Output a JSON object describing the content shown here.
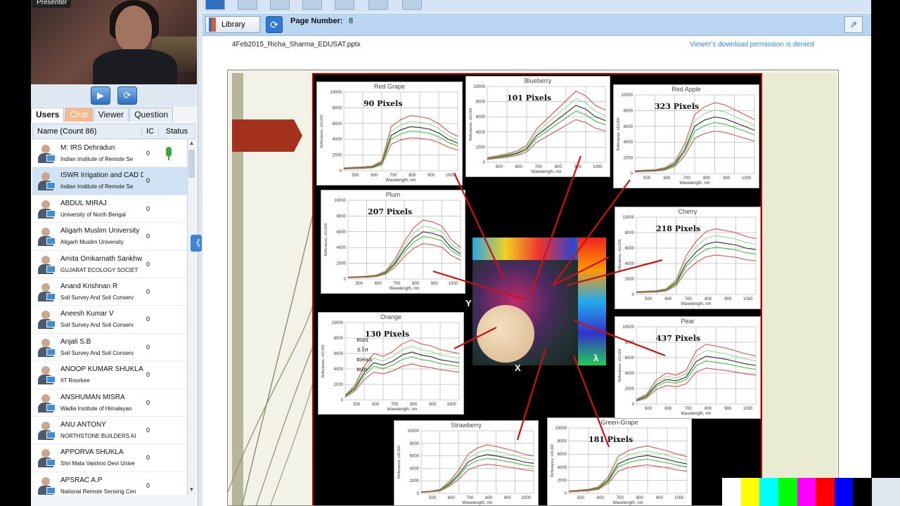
{
  "presenter": {
    "badge": "Presenter"
  },
  "tabs": [
    {
      "label": "Users",
      "state": "active"
    },
    {
      "label": "Chat",
      "state": "highlight"
    },
    {
      "label": "Viewer",
      "state": ""
    },
    {
      "label": "Question",
      "state": ""
    }
  ],
  "columns": {
    "name": "Name (Count 86)",
    "ic": "IC",
    "status": "Status"
  },
  "users": [
    {
      "name": "M: IRS Dehradun",
      "org": "Indian Institute of Remote Se",
      "ic": "0",
      "mic": true,
      "selected": false
    },
    {
      "name": "ISWR Irrigation and CAD D",
      "org": "Indian Institute of Remote Se",
      "ic": "0",
      "mic": false,
      "selected": true
    },
    {
      "name": "ABDUL MIRAJ",
      "org": "University of North Bengal",
      "ic": "0",
      "mic": false,
      "selected": false
    },
    {
      "name": "Aligarh Muslim University",
      "org": "Aligarh Muslim University",
      "ic": "0",
      "mic": false,
      "selected": false
    },
    {
      "name": "Amita Omkarnath Sankhw",
      "org": "GUJARAT ECOLOGY SOCIET",
      "ic": "0",
      "mic": false,
      "selected": false
    },
    {
      "name": "Anand Krishnan R",
      "org": "Soil Survey And Soil Conserv",
      "ic": "0",
      "mic": false,
      "selected": false
    },
    {
      "name": "Aneesh Kumar V",
      "org": "Soil Survey And Soil Conserv",
      "ic": "0",
      "mic": false,
      "selected": false
    },
    {
      "name": "Anjali S.B",
      "org": "Soil Survey And Soil Conserv",
      "ic": "0",
      "mic": false,
      "selected": false
    },
    {
      "name": "ANOOP KUMAR SHUKLA",
      "org": "IIT Roorkee",
      "ic": "0",
      "mic": false,
      "selected": false
    },
    {
      "name": "ANSHUMAN MISRA",
      "org": "Wadia Institute of Himalayan",
      "ic": "0",
      "mic": false,
      "selected": false
    },
    {
      "name": "ANU ANTONY",
      "org": "NORTHSTONE BUILDERS AI",
      "ic": "0",
      "mic": false,
      "selected": false
    },
    {
      "name": "APPORVA SHUKLA",
      "org": "Shri Mata Vaishno Devi Unive",
      "ic": "0",
      "mic": false,
      "selected": false
    },
    {
      "name": "APSRAC A.P",
      "org": "National Remote Sensing Cen",
      "ic": "0",
      "mic": false,
      "selected": false
    }
  ],
  "toolbar": {
    "library_label": "Library",
    "page_label": "Page Number:",
    "page_number": "8",
    "filename": "4Feb2015_Richa_Sharma_EDUSAT.pptx",
    "permission": "Viewer's download permission is denied"
  },
  "slide": {
    "axis_label": "Wavelength, nm",
    "ylabel": "Reflectance, x10,000",
    "x_ticks": [
      "500",
      "600",
      "700",
      "800",
      "900",
      "1000"
    ],
    "y_ticks": [
      "0",
      "2000",
      "4000",
      "6000",
      "8000",
      "10000"
    ],
    "legend": [
      "max",
      "±1σ",
      "mean",
      "min"
    ],
    "cube_labels": {
      "x": "X",
      "y": "Y",
      "z": "λ"
    },
    "charts": [
      {
        "title": "Red Grape",
        "pixels": "90 Pixels",
        "mean": [
          300,
          350,
          400,
          500,
          1000,
          4500,
          5200,
          5600,
          5500,
          5300,
          4800,
          4000,
          3500
        ]
      },
      {
        "title": "Blueberry",
        "pixels": "101 Pixels",
        "mean": [
          500,
          700,
          900,
          1200,
          1800,
          3500,
          4500,
          5500,
          6500,
          7500,
          7000,
          6000,
          5500
        ]
      },
      {
        "title": "Red Apple",
        "pixels": "323 Pixels",
        "mean": [
          300,
          350,
          400,
          600,
          1200,
          3000,
          6000,
          6800,
          7200,
          7000,
          6500,
          6000,
          5500
        ]
      },
      {
        "title": "Plum",
        "pixels": "207 Pixels",
        "mean": [
          200,
          250,
          300,
          400,
          800,
          2000,
          3800,
          5200,
          6000,
          5800,
          5400,
          4000,
          3200
        ]
      },
      {
        "title": "Cherry",
        "pixels": "218 Pixels",
        "mean": [
          300,
          350,
          400,
          600,
          1500,
          4000,
          5500,
          6500,
          6800,
          6600,
          6400,
          6000,
          5800
        ]
      },
      {
        "title": "Orange",
        "pixels": "130 Pixels",
        "mean": [
          500,
          1500,
          3500,
          4800,
          4500,
          5000,
          5800,
          6200,
          5800,
          5600,
          5200,
          5000,
          4800
        ]
      },
      {
        "title": "Pear",
        "pixels": "437 Pixels",
        "mean": [
          500,
          1000,
          2500,
          3200,
          3000,
          3500,
          5500,
          6200,
          6000,
          5800,
          5500,
          5200,
          5000
        ]
      },
      {
        "title": "Strawberry",
        "pixels": "",
        "mean": [
          200,
          300,
          500,
          1500,
          3000,
          5000,
          5800,
          6200,
          6000,
          5700,
          5400,
          5000,
          4800
        ]
      },
      {
        "title": "Green-Grape",
        "pixels": "181 Pixels",
        "mean": [
          300,
          400,
          500,
          800,
          2000,
          4500,
          5200,
          5600,
          5800,
          5500,
          5200,
          4800,
          4500
        ]
      }
    ]
  },
  "colors": {
    "accent": "#2f6fc1",
    "chat_tab": "#f7b98c",
    "panel_border": "#b00",
    "permission": "#2f86d6"
  },
  "test_bars": [
    "#ffffff",
    "#ffff00",
    "#00ffff",
    "#00ff00",
    "#ff00ff",
    "#ff0000",
    "#0000ff",
    "#000000"
  ]
}
